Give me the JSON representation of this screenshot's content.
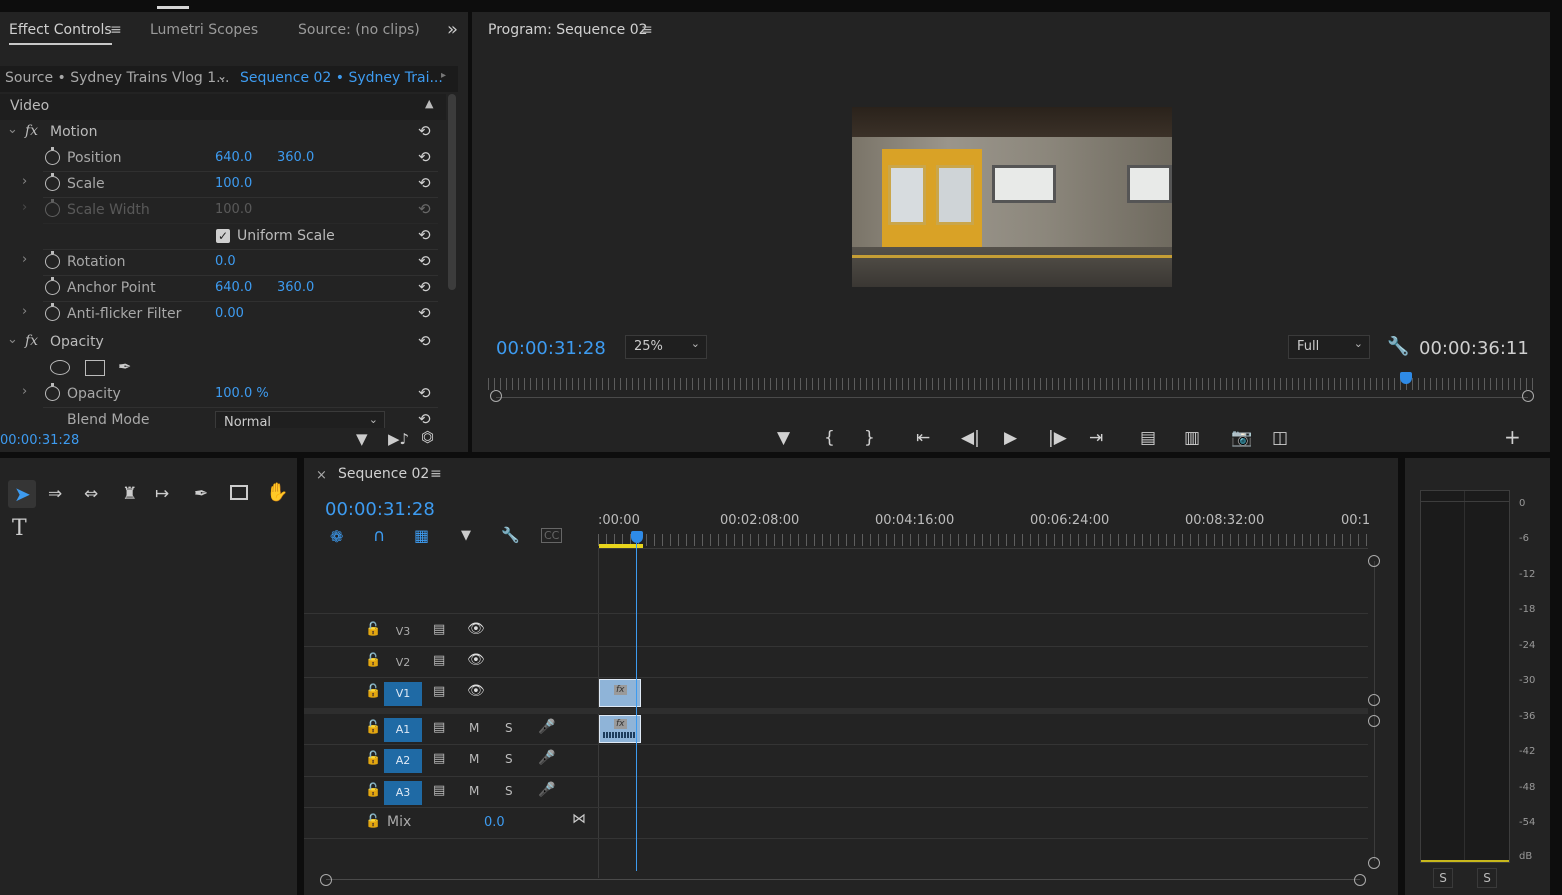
{
  "effect_controls": {
    "tabs": [
      "Effect Controls",
      "Lumetri Scopes",
      "Source: (no clips)"
    ],
    "menu_icon": "≡",
    "overflow_icon": "»",
    "source_label": "Source • Sydney Trains Vlog 1...",
    "sequence_label": "Sequence 02 • Sydney Trai...",
    "section_video": "Video",
    "motion": {
      "name": "Motion",
      "position": {
        "label": "Position",
        "x": "640.0",
        "y": "360.0"
      },
      "scale": {
        "label": "Scale",
        "value": "100.0"
      },
      "scale_width": {
        "label": "Scale Width",
        "value": "100.0"
      },
      "uniform_scale": {
        "label": "Uniform Scale",
        "checked": true
      },
      "rotation": {
        "label": "Rotation",
        "value": "0.0"
      },
      "anchor_point": {
        "label": "Anchor Point",
        "x": "640.0",
        "y": "360.0"
      },
      "anti_flicker": {
        "label": "Anti-flicker Filter",
        "value": "0.00"
      }
    },
    "opacity": {
      "name": "Opacity",
      "opacity": {
        "label": "Opacity",
        "value": "100.0 %"
      },
      "blend_mode": {
        "label": "Blend Mode",
        "value": "Normal"
      }
    },
    "footer_timecode": "00:00:31:28"
  },
  "program_monitor": {
    "title": "Program: Sequence 02",
    "menu_icon": "≡",
    "playhead_timecode": "00:00:31:28",
    "zoom": "25%",
    "resolution": "Full",
    "duration": "00:00:36:11",
    "controls": [
      "marker-icon",
      "mark-in-icon",
      "mark-out-icon",
      "go-to-in-icon",
      "step-back-icon",
      "play-icon",
      "step-forward-icon",
      "go-to-out-icon",
      "lift-icon",
      "extract-icon",
      "export-frame-icon",
      "comparison-view-icon",
      "add-button-icon"
    ],
    "playhead_fraction": 0.878
  },
  "timeline": {
    "tab_close": "×",
    "title": "Sequence 02",
    "menu_icon": "≡",
    "timecode": "00:00:31:28",
    "ruler_labels": [
      ":00:00",
      "00:02:08:00",
      "00:04:16:00",
      "00:06:24:00",
      "00:08:32:00",
      "00:1"
    ],
    "video_tracks": [
      "V3",
      "V2",
      "V1"
    ],
    "audio_tracks": [
      "A1",
      "A2",
      "A3"
    ],
    "mute_label": "M",
    "solo_label": "S",
    "mix_label": "Mix",
    "mix_value": "0.0"
  },
  "audio_meter": {
    "scale": [
      "0",
      "-6",
      "-12",
      "-18",
      "-24",
      "-30",
      "-36",
      "-42",
      "-48",
      "-54",
      "dB"
    ],
    "solo_buttons": [
      "S",
      "S"
    ]
  },
  "colors": {
    "accent_blue": "#3d9bf0",
    "track_target": "#1f6aa5",
    "work_area": "#e8d51c",
    "panel_bg": "#232323"
  }
}
